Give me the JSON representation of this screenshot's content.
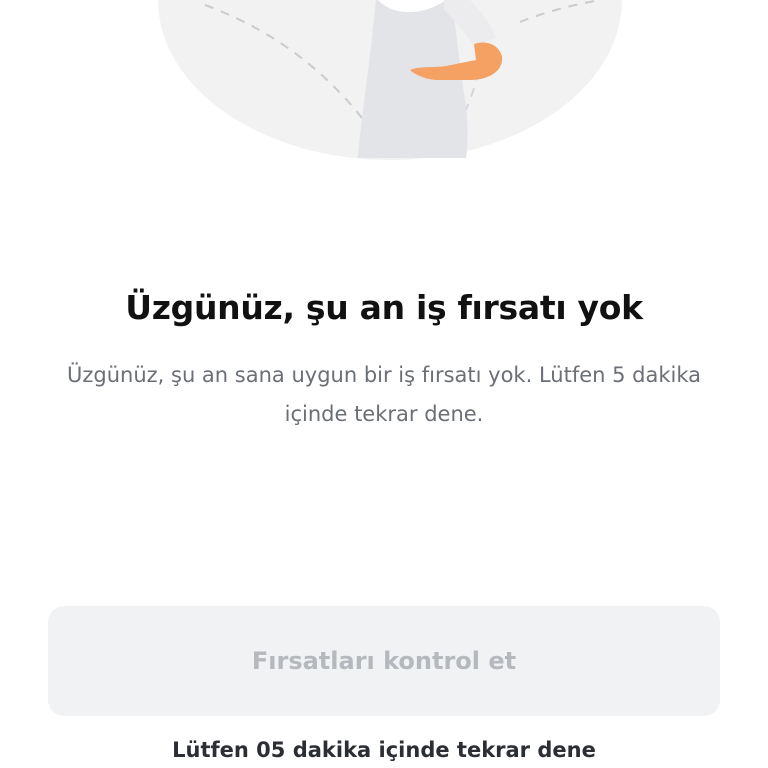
{
  "empty_state": {
    "illustration_icon": "person-illustration",
    "title": "Üzgünüz, şu an iş fırsatı yok",
    "message": "Üzgünüz, şu an sana uygun bir iş fırsatı yok. Lütfen 5 dakika içinde tekrar dene."
  },
  "actions": {
    "check_button_label": "Fırsatları kontrol et",
    "check_button_state": "disabled",
    "retry_note": "Lütfen 05 dakika içinde tekrar dene"
  },
  "colors": {
    "background": "#ffffff",
    "illustration_circle": "#f2f2f3",
    "button_bg": "#f1f2f4",
    "button_text": "#b5b8bd",
    "skin": "#f6a164",
    "message_text": "#6b6f76"
  }
}
